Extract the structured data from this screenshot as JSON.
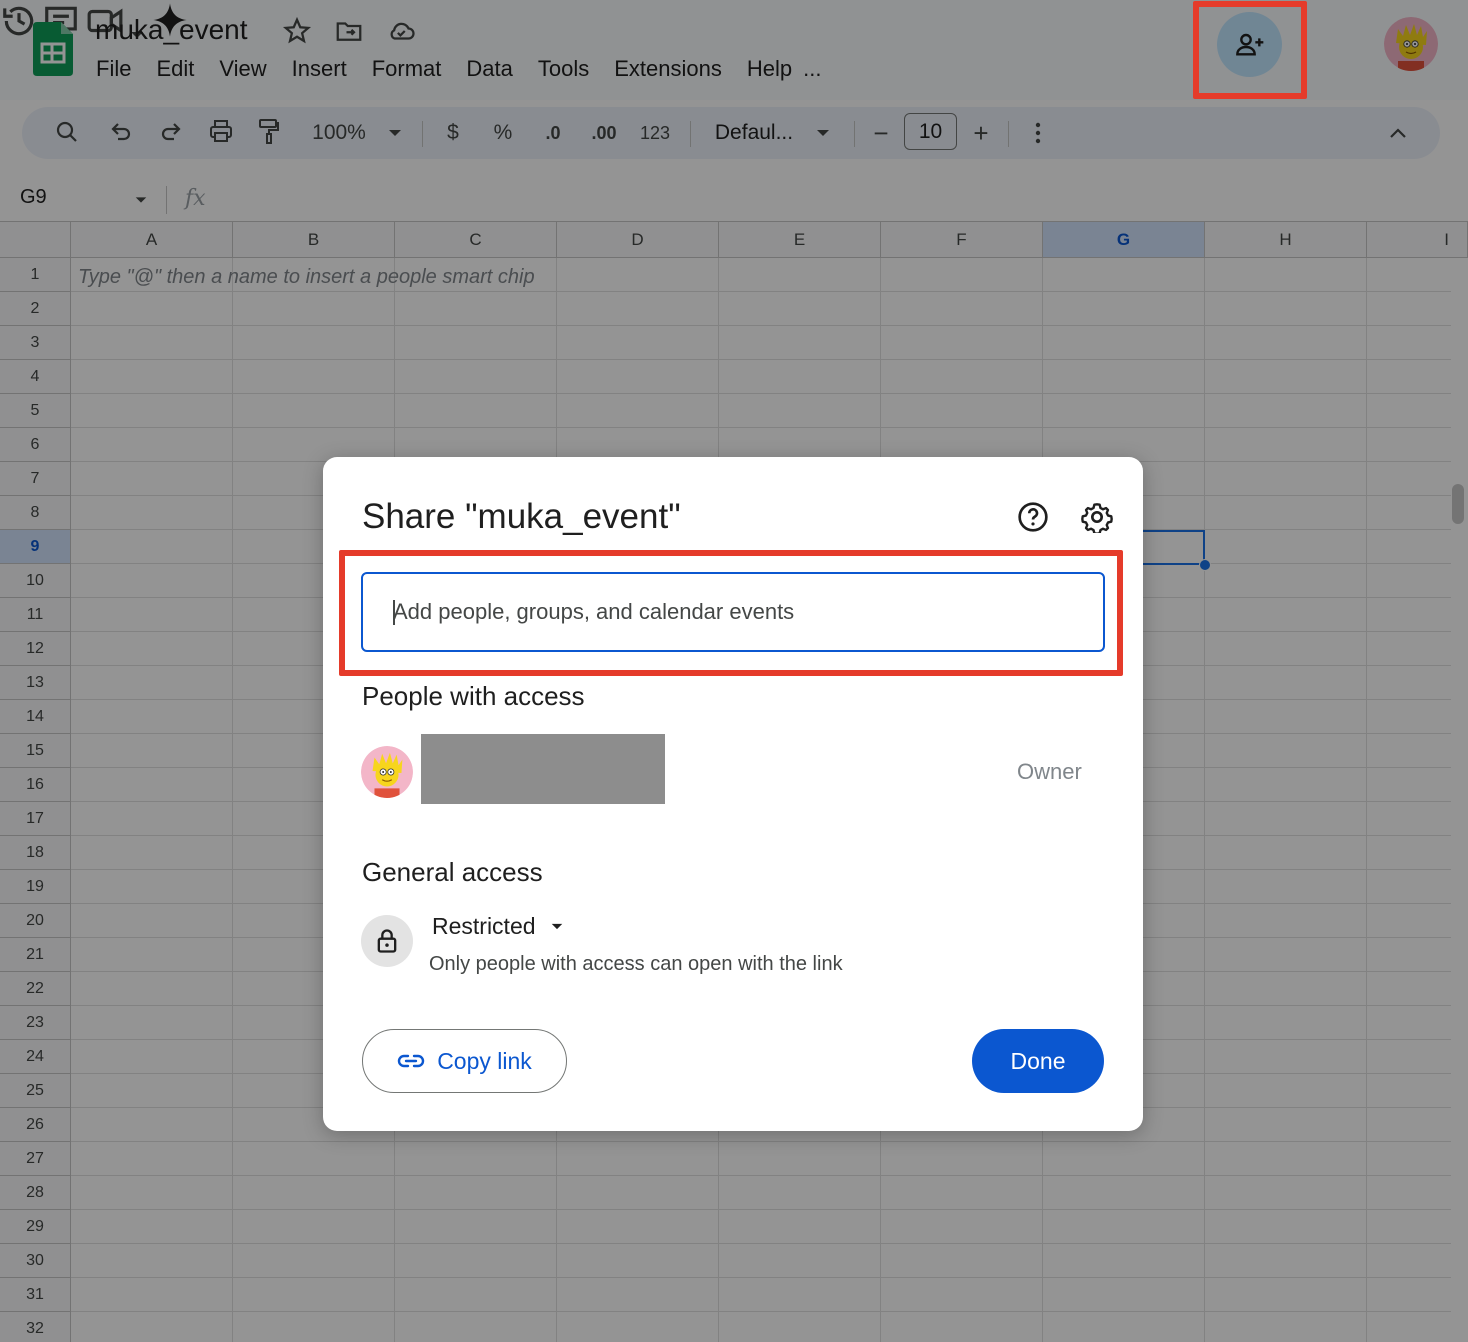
{
  "app": {
    "doc_title": "muka_event",
    "menu": [
      "File",
      "Edit",
      "View",
      "Insert",
      "Format",
      "Data",
      "Tools",
      "Extensions",
      "Help",
      "..."
    ]
  },
  "toolbar": {
    "zoom": "100%",
    "currency": "$",
    "percent": "%",
    "decrease_decimal": ".0",
    "increase_decimal": ".00",
    "number_format": "123",
    "font": "Defaul...",
    "minus": "−",
    "font_size": "10",
    "plus": "+"
  },
  "formula_bar": {
    "cell_ref": "G9",
    "fx": "fx"
  },
  "grid": {
    "columns": [
      "A",
      "B",
      "C",
      "D",
      "E",
      "F",
      "G",
      "H",
      "I"
    ],
    "selected_column": "G",
    "rows": [
      "1",
      "2",
      "3",
      "4",
      "5",
      "6",
      "7",
      "8",
      "9",
      "10",
      "11",
      "12",
      "13",
      "14",
      "15",
      "16",
      "17",
      "18",
      "19",
      "20",
      "21",
      "22",
      "23",
      "24",
      "25",
      "26",
      "27",
      "28",
      "29",
      "30",
      "31",
      "32"
    ],
    "selected_row": "9",
    "a1_hint": "Type \"@\" then a name to insert a people smart chip"
  },
  "share_dialog": {
    "title": "Share \"muka_event\"",
    "input_placeholder": "Add people, groups, and calendar events",
    "people_heading": "People with access",
    "owner_role": "Owner",
    "general_heading": "General access",
    "access_level": "Restricted",
    "access_description": "Only people with access can open with the link",
    "copy_link_label": "Copy link",
    "done_label": "Done"
  },
  "colors": {
    "accent": "#0b57d0",
    "highlight": "#e53b2a",
    "sheets_green": "#0f9d58"
  }
}
